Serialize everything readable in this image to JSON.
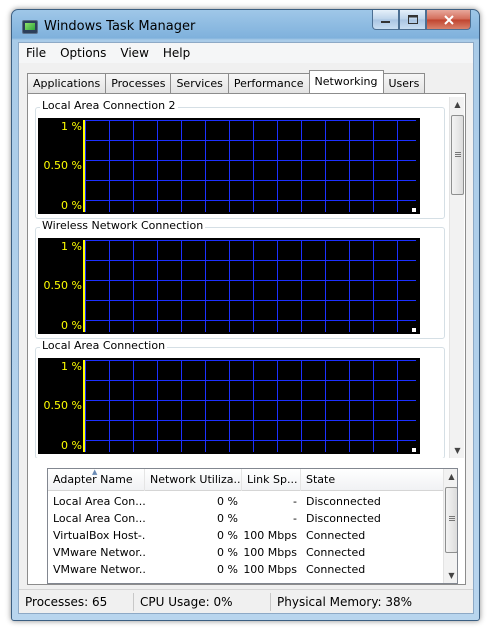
{
  "window": {
    "title": "Windows Task Manager"
  },
  "menu": [
    "File",
    "Options",
    "View",
    "Help"
  ],
  "tabs": [
    {
      "label": "Applications",
      "active": false
    },
    {
      "label": "Processes",
      "active": false
    },
    {
      "label": "Services",
      "active": false
    },
    {
      "label": "Performance",
      "active": false
    },
    {
      "label": "Networking",
      "active": true
    },
    {
      "label": "Users",
      "active": false
    }
  ],
  "graphs": [
    {
      "title": "Local Area Connection 2",
      "y_top": "1 %",
      "y_mid": "0.50 %",
      "y_bottom": "0 %"
    },
    {
      "title": "Wireless Network Connection",
      "y_top": "1 %",
      "y_mid": "0.50 %",
      "y_bottom": "0 %"
    },
    {
      "title": "Local Area Connection",
      "y_top": "1 %",
      "y_mid": "0.50 %",
      "y_bottom": "0 %"
    }
  ],
  "adapters": {
    "columns": [
      "Adapter Name",
      "Network Utiliza...",
      "Link Sp...",
      "State"
    ],
    "rows": [
      {
        "name": "Local Area Con...",
        "utilization": "0 %",
        "link_speed": "-",
        "state": "Disconnected"
      },
      {
        "name": "Local Area Con...",
        "utilization": "0 %",
        "link_speed": "-",
        "state": "Disconnected"
      },
      {
        "name": "VirtualBox Host-...",
        "utilization": "0 %",
        "link_speed": "100 Mbps",
        "state": "Connected"
      },
      {
        "name": "VMware Networ...",
        "utilization": "0 %",
        "link_speed": "100 Mbps",
        "state": "Connected"
      },
      {
        "name": "VMware Networ...",
        "utilization": "0 %",
        "link_speed": "100 Mbps",
        "state": "Connected"
      }
    ]
  },
  "status": {
    "processes": "Processes: 65",
    "cpu": "CPU Usage: 0%",
    "memory": "Physical Memory: 38%"
  },
  "colors": {
    "graph_background": "#000000",
    "graph_grid": "#1c30ff",
    "graph_axis_text": "#ffff00"
  },
  "icons": {
    "minimize": "minimize-icon",
    "maximize": "maximize-icon",
    "close": "close-icon",
    "app": "task-manager-icon"
  }
}
